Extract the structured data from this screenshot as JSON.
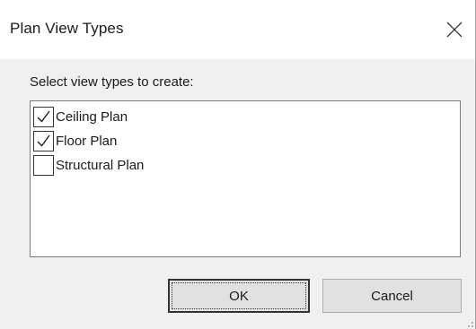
{
  "dialog": {
    "title": "Plan View Types",
    "close_icon": "close-icon"
  },
  "content": {
    "prompt": "Select view types to create:",
    "view_types": [
      {
        "label": "Ceiling Plan",
        "checked": true
      },
      {
        "label": "Floor Plan",
        "checked": true
      },
      {
        "label": "Structural Plan",
        "checked": false
      }
    ]
  },
  "buttons": {
    "ok_label": "OK",
    "cancel_label": "Cancel"
  }
}
